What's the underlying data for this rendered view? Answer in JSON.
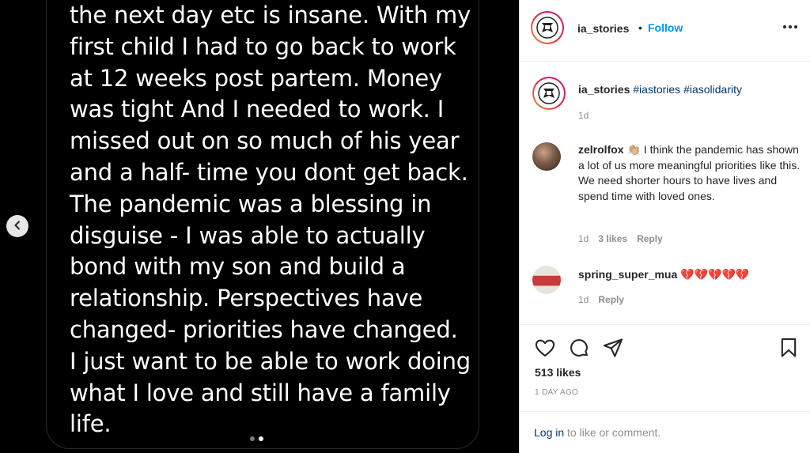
{
  "story": {
    "lines": [
      "the next day etc is insane. With my",
      "first child I had to go back to work",
      "at 12 weeks post partem. Money",
      "was tight And I needed to work. I",
      "missed out on so much of his year",
      "and a half- time you dont get back.",
      "The pandemic was a blessing in",
      "disguise - I was able to actually",
      "bond with my son and build a",
      "relationship. Perspectives have",
      "changed- priorities have changed.",
      "I just want to be able to work doing",
      "what I love and still have a family",
      "life."
    ],
    "prev_icon": "chevron-left-icon",
    "slide_count": 2,
    "active_slide": 2
  },
  "header": {
    "username": "ia_stories",
    "separator": "•",
    "follow_label": "Follow",
    "more_icon": "more-options-icon"
  },
  "caption": {
    "username": "ia_stories",
    "tags": "#iastories #iasolidarity",
    "time": "1d"
  },
  "comments": [
    {
      "username": "zelrolfox",
      "emoji": "👏🏼",
      "text": "I think the pandemic has shown a lot of us more meaningful priorities like this. We need shorter hours to have lives and spend time with loved ones.",
      "time": "1d",
      "likes": "3 likes",
      "reply": "Reply"
    },
    {
      "username": "spring_super_mua",
      "text": "💔💔💔💔💔",
      "time": "1d",
      "reply": "Reply"
    }
  ],
  "actions": {
    "icons": [
      "heart-icon",
      "comment-icon",
      "share-icon",
      "bookmark-icon"
    ],
    "likes": "513 likes",
    "posted": "1 DAY AGO"
  },
  "footer": {
    "login_link": "Log in",
    "login_rest": " to like or comment."
  },
  "colors": {
    "link_blue": "#0095f6",
    "tag_blue": "#00376b",
    "muted": "#8e8e8e",
    "text": "#262626"
  }
}
